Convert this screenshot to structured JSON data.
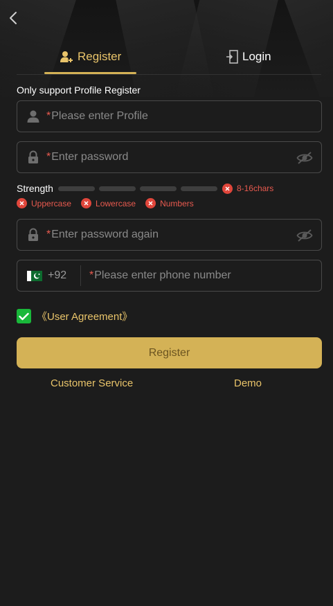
{
  "tabs": {
    "register_label": "Register",
    "login_label": "Login"
  },
  "section_label": "Only support Profile Register",
  "fields": {
    "profile": {
      "required_mark": "*",
      "placeholder": "Please enter Profile"
    },
    "password": {
      "required_mark": "*",
      "placeholder": "Enter password"
    },
    "password_again": {
      "required_mark": "*",
      "placeholder": "Enter password again"
    },
    "phone": {
      "country_code": "+92",
      "required_mark": "*",
      "placeholder": "Please enter phone number"
    }
  },
  "strength": {
    "label": "Strength",
    "level": 0,
    "rules": {
      "length": "8-16chars",
      "uppercase": "Uppercase",
      "lowercase": "Lowercase",
      "numbers": "Numbers"
    }
  },
  "agreement": {
    "checked": true,
    "label": "《User Agreement》"
  },
  "register_button": "Register",
  "links": {
    "customer_service": "Customer Service",
    "demo": "Demo"
  },
  "colors": {
    "accent": "#d4b256",
    "error": "#e0463b",
    "check": "#19b83a",
    "background": "#1c1c1c"
  },
  "icons": [
    "back-arrow-icon",
    "add-user-icon",
    "login-door-icon",
    "user-icon",
    "lock-icon",
    "eye-off-icon",
    "pakistan-flag-icon",
    "checkmark-icon",
    "close-x-icon"
  ]
}
